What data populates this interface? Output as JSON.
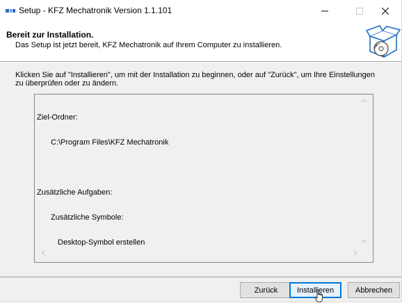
{
  "window": {
    "title": "Setup - KFZ Mechatronik Version 1.1.101",
    "icons": [
      "setup-app-icon",
      "minimize-icon",
      "maximize-icon",
      "close-icon"
    ]
  },
  "header": {
    "title": "Bereit zur Installation.",
    "subtitle": "Das Setup ist jetzt bereit, KFZ Mechatronik auf Ihrem Computer zu installieren.",
    "graphic_icon": "install-box-disc-icon"
  },
  "body": {
    "instruction": "Klicken Sie auf \"Installieren\", um mit der Installation zu beginnen, oder auf \"Zurück\", um Ihre Einstellungen zu überprüfen oder zu ändern.",
    "memo": {
      "dest_label": "Ziel-Ordner:",
      "dest_value": "C:\\Program Files\\KFZ Mechatronik",
      "tasks_label": "Zusätzliche Aufgaben:",
      "tasks_group": "Zusätzliche Symbole:",
      "tasks_item": "Desktop-Symbol erstellen"
    }
  },
  "footer": {
    "back_label": "Zurück",
    "install_label": "Installieren",
    "cancel_label": "Abbrechen"
  },
  "colors": {
    "accent": "#0078d7",
    "panel": "#f0f0f0",
    "button": "#e1e1e1"
  }
}
